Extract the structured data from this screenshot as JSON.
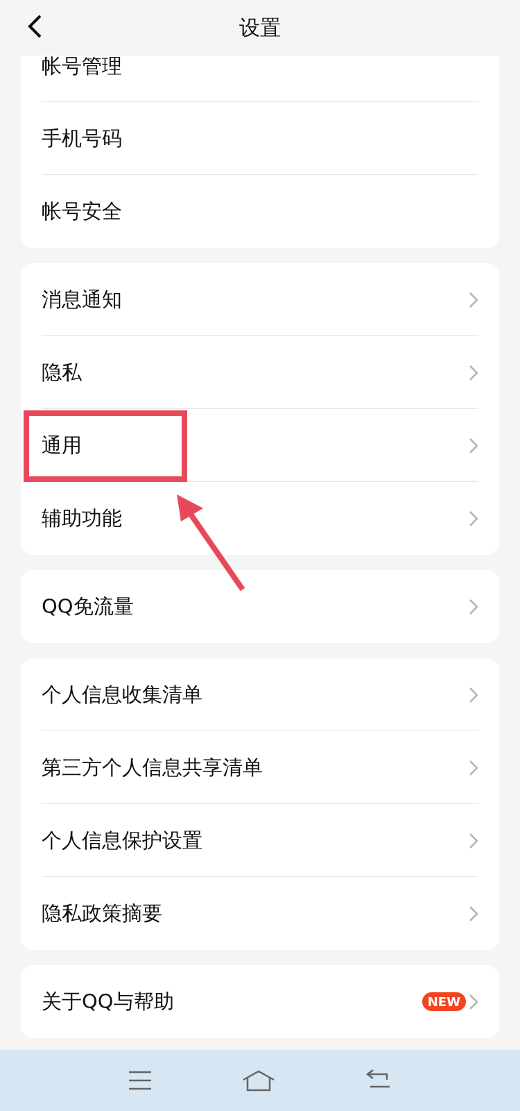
{
  "header": {
    "title": "设置"
  },
  "groups": [
    {
      "items": [
        {
          "label": "帐号管理",
          "arrow": false,
          "highlighted": false
        },
        {
          "label": "手机号码",
          "arrow": false,
          "highlighted": false
        },
        {
          "label": "帐号安全",
          "arrow": false,
          "highlighted": false
        }
      ]
    },
    {
      "items": [
        {
          "label": "消息通知",
          "arrow": true,
          "highlighted": false
        },
        {
          "label": "隐私",
          "arrow": true,
          "highlighted": false
        },
        {
          "label": "通用",
          "arrow": true,
          "highlighted": true
        },
        {
          "label": "辅助功能",
          "arrow": true,
          "highlighted": false
        }
      ]
    },
    {
      "items": [
        {
          "label": "QQ免流量",
          "arrow": true,
          "highlighted": false
        }
      ]
    },
    {
      "items": [
        {
          "label": "个人信息收集清单",
          "arrow": true,
          "highlighted": false
        },
        {
          "label": "第三方个人信息共享清单",
          "arrow": true,
          "highlighted": false
        },
        {
          "label": "个人信息保护设置",
          "arrow": true,
          "highlighted": false
        },
        {
          "label": "隐私政策摘要",
          "arrow": true,
          "highlighted": false
        }
      ]
    },
    {
      "items": [
        {
          "label": "关于QQ与帮助",
          "arrow": true,
          "highlighted": false,
          "badge": "NEW"
        }
      ]
    }
  ]
}
